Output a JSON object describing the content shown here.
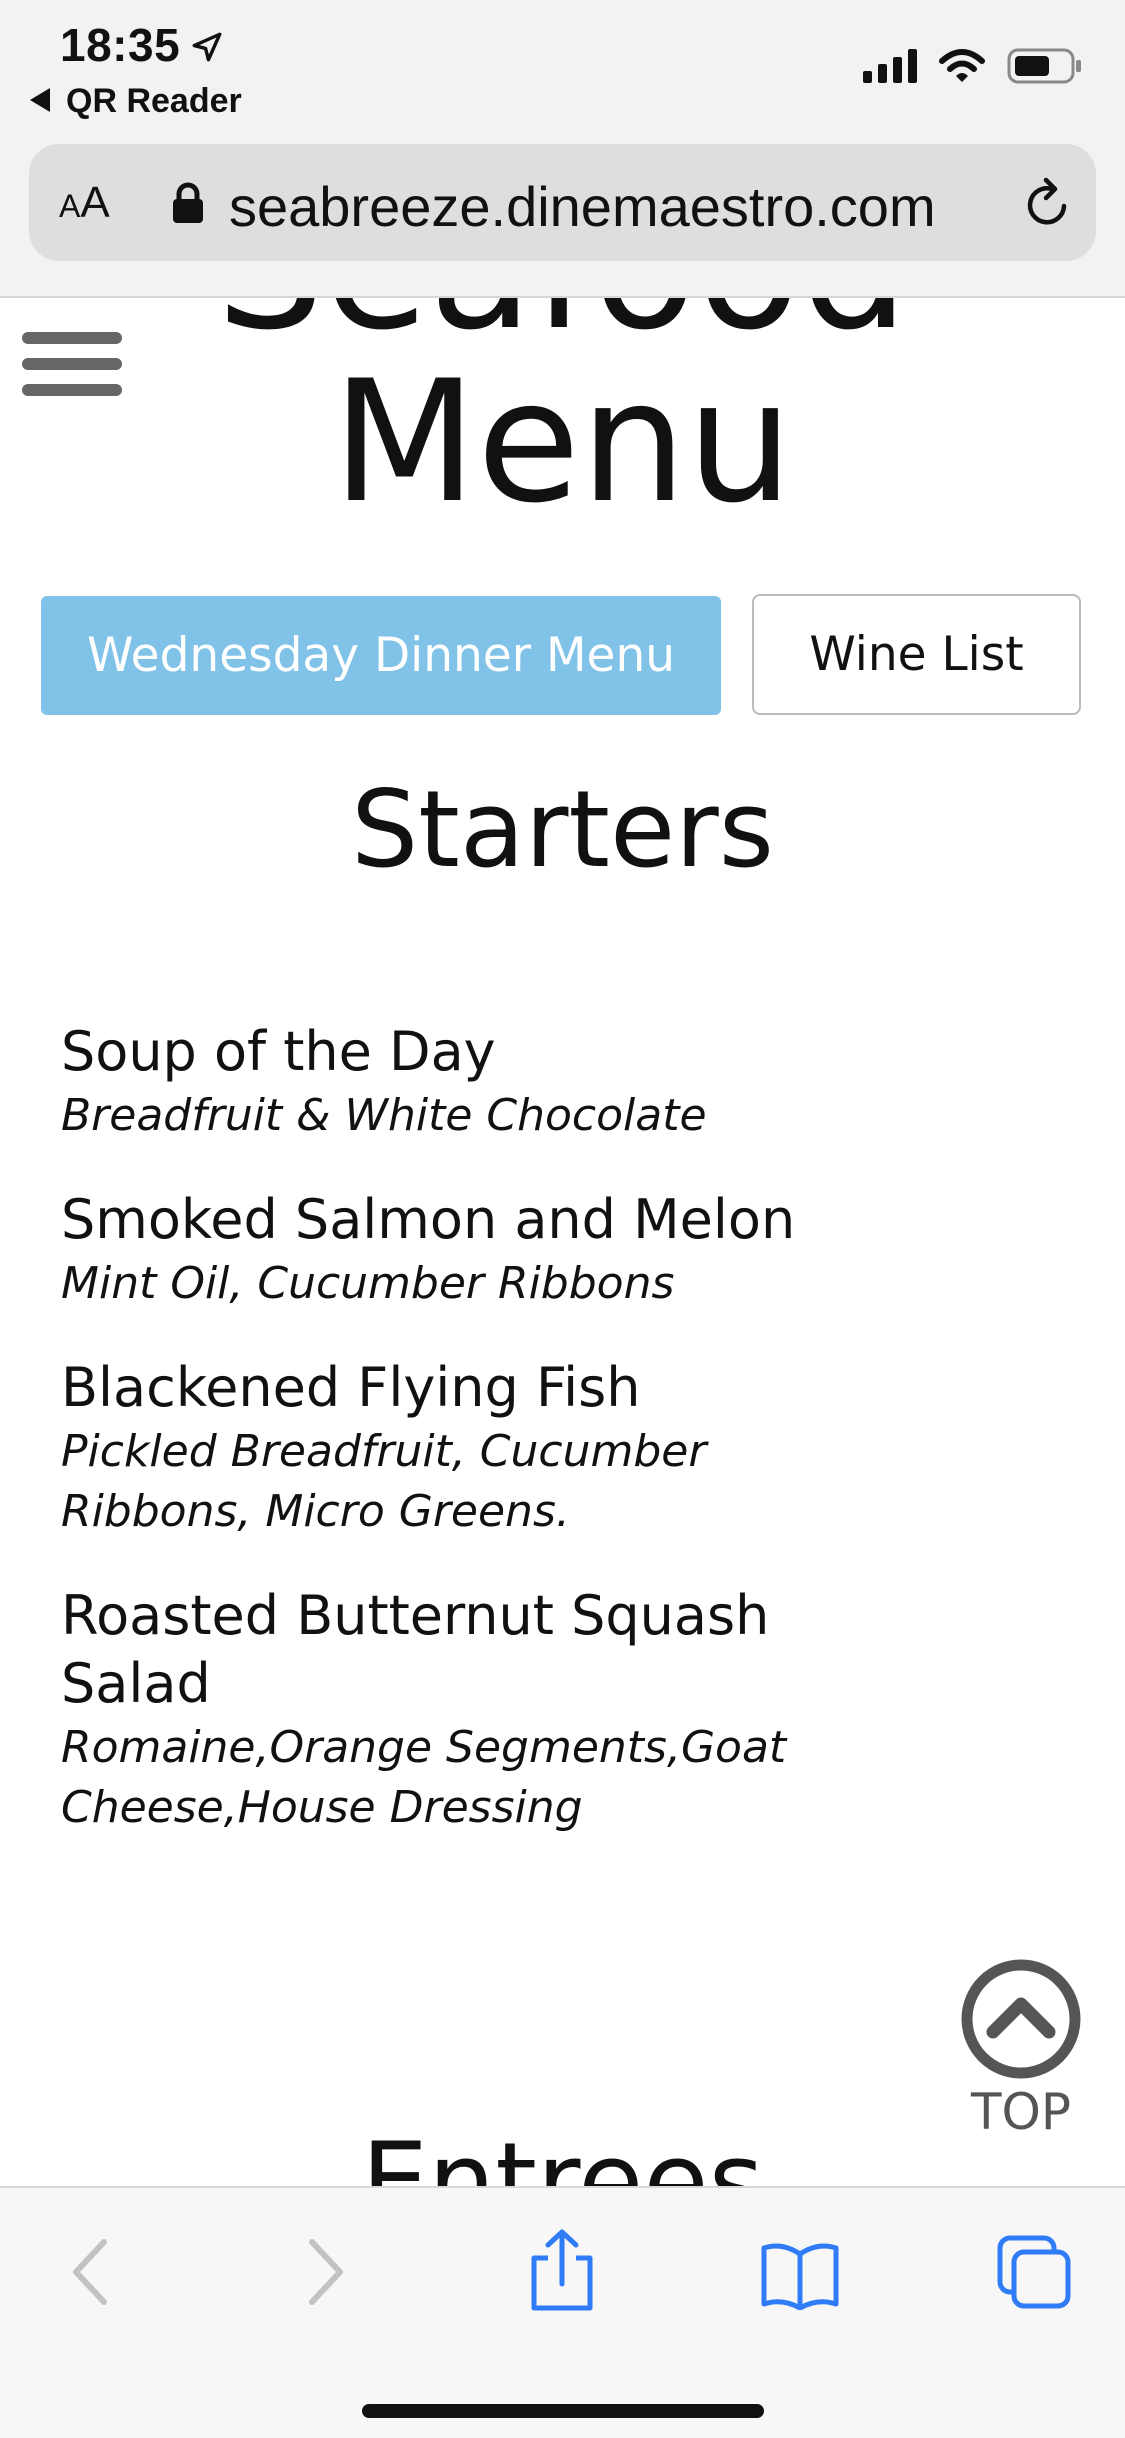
{
  "status_bar": {
    "time": "18:35",
    "back_app_label": "QR Reader"
  },
  "browser": {
    "text_size_label_small": "A",
    "text_size_label_large": "A",
    "url": "seabreeze.dinemaestro.com"
  },
  "page": {
    "title_top_partial": "Seafood",
    "title": "Menu",
    "tabs": [
      {
        "label": "Wednesday Dinner Menu",
        "active": true,
        "color": "#80c2e8"
      },
      {
        "label": "Wine List",
        "active": false
      }
    ],
    "section_title": "Starters",
    "items": [
      {
        "name": "Soup of the Day",
        "description": "Breadfruit & White Chocolate"
      },
      {
        "name": "Smoked Salmon and Melon",
        "description": "Mint Oil, Cucumber Ribbons"
      },
      {
        "name": "Blackened Flying Fish",
        "description": "Pickled Breadfruit, Cucumber Ribbons, Micro Greens."
      },
      {
        "name": "Roasted Butternut Squash Salad",
        "description": "Romaine,Orange Segments,Goat Cheese,House Dressing"
      }
    ],
    "top_button_label": "TOP",
    "next_section_title": "Entrees"
  },
  "toolbar": {
    "icons": [
      "back-icon",
      "forward-icon",
      "share-icon",
      "bookmarks-icon",
      "tabs-icon"
    ],
    "accent": "#2f7cf6"
  }
}
